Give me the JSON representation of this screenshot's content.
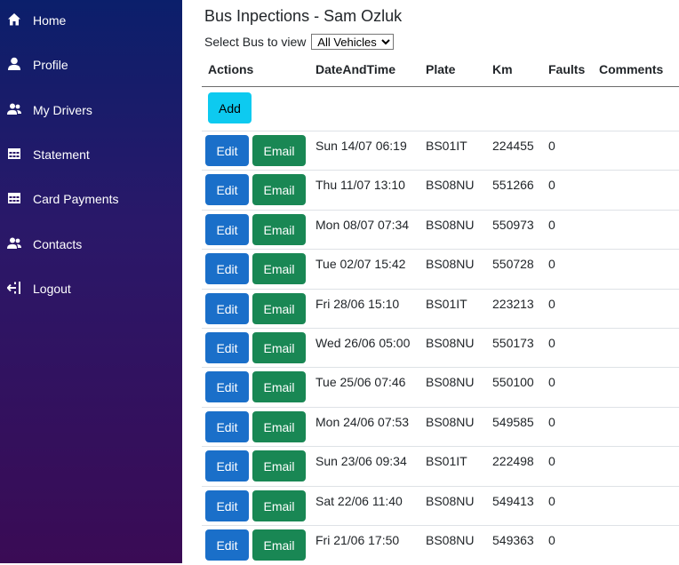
{
  "sidebar": {
    "items": [
      {
        "label": "Home",
        "icon": "home-icon"
      },
      {
        "label": "Profile",
        "icon": "user-icon"
      },
      {
        "label": "My Drivers",
        "icon": "users-icon"
      },
      {
        "label": "Statement",
        "icon": "table-icon"
      },
      {
        "label": "Card Payments",
        "icon": "table-icon"
      },
      {
        "label": "Contacts",
        "icon": "users-icon"
      },
      {
        "label": "Logout",
        "icon": "logout-icon"
      }
    ]
  },
  "page": {
    "title": "Bus Inpections - Sam Ozluk",
    "filter_label": "Select Bus to view",
    "filter_selected": "All Vehicles",
    "add_label": "Add",
    "edit_label": "Edit",
    "email_label": "Email"
  },
  "table": {
    "headers": [
      "Actions",
      "DateAndTime",
      "Plate",
      "Km",
      "Faults",
      "Comments"
    ],
    "rows": [
      {
        "date": "Sun 14/07 06:19",
        "plate": "BS01IT",
        "km": "224455",
        "faults": "0",
        "comments": ""
      },
      {
        "date": "Thu 11/07 13:10",
        "plate": "BS08NU",
        "km": "551266",
        "faults": "0",
        "comments": ""
      },
      {
        "date": "Mon 08/07 07:34",
        "plate": "BS08NU",
        "km": "550973",
        "faults": "0",
        "comments": ""
      },
      {
        "date": "Tue 02/07 15:42",
        "plate": "BS08NU",
        "km": "550728",
        "faults": "0",
        "comments": ""
      },
      {
        "date": "Fri 28/06 15:10",
        "plate": "BS01IT",
        "km": "223213",
        "faults": "0",
        "comments": ""
      },
      {
        "date": "Wed 26/06 05:00",
        "plate": "BS08NU",
        "km": "550173",
        "faults": "0",
        "comments": ""
      },
      {
        "date": "Tue 25/06 07:46",
        "plate": "BS08NU",
        "km": "550100",
        "faults": "0",
        "comments": ""
      },
      {
        "date": "Mon 24/06 07:53",
        "plate": "BS08NU",
        "km": "549585",
        "faults": "0",
        "comments": ""
      },
      {
        "date": "Sun 23/06 09:34",
        "plate": "BS01IT",
        "km": "222498",
        "faults": "0",
        "comments": ""
      },
      {
        "date": "Sat 22/06 11:40",
        "plate": "BS08NU",
        "km": "549413",
        "faults": "0",
        "comments": ""
      },
      {
        "date": "Fri 21/06 17:50",
        "plate": "BS08NU",
        "km": "549363",
        "faults": "0",
        "comments": ""
      }
    ]
  }
}
